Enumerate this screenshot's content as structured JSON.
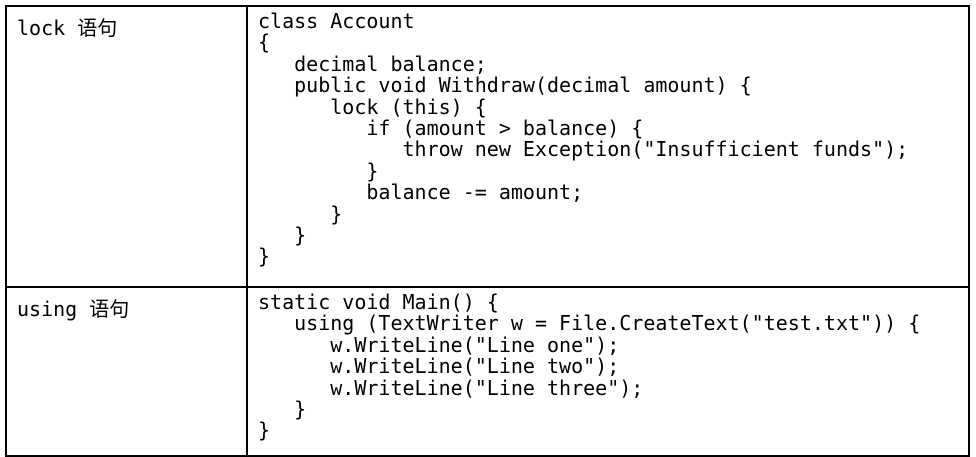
{
  "rows": [
    {
      "label": "lock 语句",
      "code": "class Account\n{\n   decimal balance;\n   public void Withdraw(decimal amount) {\n      lock (this) {\n         if (amount > balance) {\n            throw new Exception(\"Insufficient funds\");\n         }\n         balance -= amount;\n      }\n   }\n}"
    },
    {
      "label": "using 语句",
      "code": "static void Main() {\n   using (TextWriter w = File.CreateText(\"test.txt\")) {\n      w.WriteLine(\"Line one\");\n      w.WriteLine(\"Line two\");\n      w.WriteLine(\"Line three\");\n   }\n}"
    }
  ]
}
